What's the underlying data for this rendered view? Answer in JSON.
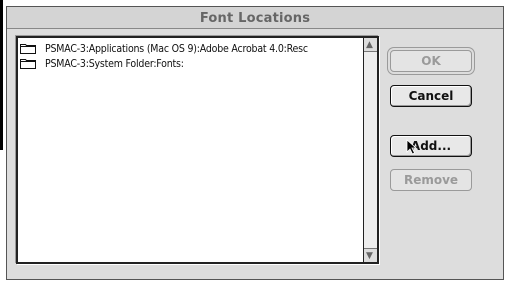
{
  "window": {
    "title": "Font Locations"
  },
  "locations": [
    {
      "icon": "folder-icon",
      "path": "PSMAC-3:Applications (Mac OS 9):Adobe Acrobat 4.0:Resc"
    },
    {
      "icon": "folder-icon",
      "path": "PSMAC-3:System Folder:Fonts:"
    }
  ],
  "buttons": {
    "ok": {
      "label": "OK",
      "enabled": false
    },
    "cancel": {
      "label": "Cancel",
      "enabled": true
    },
    "add": {
      "label": "Add...",
      "enabled": true
    },
    "remove": {
      "label": "Remove",
      "enabled": false
    }
  },
  "scrollbar": {
    "up_arrow": "up-arrow-icon",
    "down_arrow": "down-arrow-icon"
  },
  "colors": {
    "dialog_bg": "#dddddd",
    "disabled_text": "#9a9a9a"
  }
}
